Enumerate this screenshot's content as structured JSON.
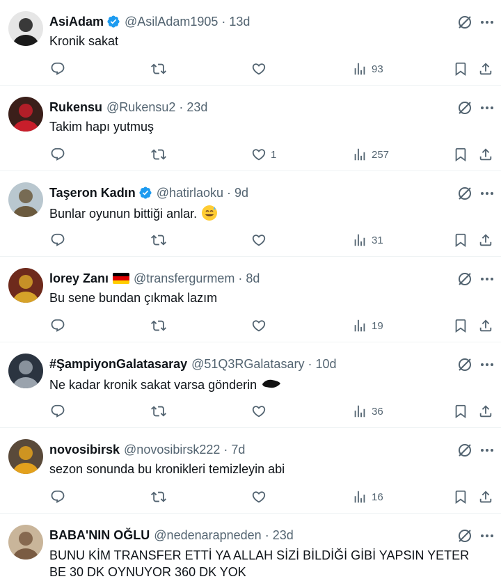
{
  "tweets": [
    {
      "name": "AsiAdam",
      "verified": true,
      "flag": false,
      "handle": "@AsilAdam1905",
      "dot": "·",
      "time": "13d",
      "text": "Kronik sakat",
      "emoji": "",
      "likes": "",
      "views": "93",
      "avatar_colors": [
        "#e6e6e6",
        "#1a1a1a"
      ]
    },
    {
      "name": "Rukensu",
      "verified": false,
      "flag": false,
      "handle": "@Rukensu2",
      "dot": "·",
      "time": "23d",
      "text": "Takim hapı yutmuş",
      "emoji": "",
      "likes": "1",
      "views": "257",
      "avatar_colors": [
        "#3b1f1a",
        "#c81e2b"
      ]
    },
    {
      "name": "Taşeron Kadın",
      "verified": true,
      "flag": false,
      "handle": "@hatirlaoku",
      "dot": "·",
      "time": "9d",
      "text": "Bunlar oyunun bittiği anlar.",
      "emoji": "sweat-smile-emoji",
      "likes": "",
      "views": "31",
      "avatar_colors": [
        "#b9c7cf",
        "#6b5a3e"
      ]
    },
    {
      "name": "lorey Zanı",
      "verified": false,
      "flag": true,
      "handle": "@transfergurmem",
      "dot": "·",
      "time": "8d",
      "text": "Bu sene bundan çıkmak lazım",
      "emoji": "",
      "likes": "",
      "views": "19",
      "avatar_colors": [
        "#6e2a1c",
        "#d6a229"
      ]
    },
    {
      "name": "#ŞampiyonGalatasaray",
      "verified": false,
      "flag": false,
      "handle": "@51Q3RGalatasary",
      "dot": "·",
      "time": "10d",
      "text": "Ne kadar kronik sakat varsa gönderin",
      "emoji": "redacted-blob",
      "likes": "",
      "views": "36",
      "avatar_colors": [
        "#2b3440",
        "#9aa3ad"
      ]
    },
    {
      "name": "novosibirsk",
      "verified": false,
      "flag": false,
      "handle": "@novosibirsk222",
      "dot": "·",
      "time": "7d",
      "text": "sezon sonunda bu kronikleri temizleyin abi",
      "emoji": "",
      "likes": "",
      "views": "16",
      "avatar_colors": [
        "#5a4a3a",
        "#e3a11d"
      ]
    },
    {
      "name": "BABA'NIN OĞLU",
      "verified": false,
      "flag": false,
      "handle": "@nedenarapneden",
      "dot": "·",
      "time": "23d",
      "text": "BUNU KİM TRANSFER ETTİ YA ALLAH SİZİ BİLDİĞİ GİBİ YAPSIN YETER BE 30 DK OYNUYOR 360 DK YOK",
      "emoji": "",
      "likes": "",
      "views": "",
      "avatar_colors": [
        "#c9b59a",
        "#7a5c43"
      ]
    }
  ],
  "colors": {
    "text": "#0f1419",
    "secondary": "#536471",
    "verified": "#1d9bf0",
    "divider": "#eff3f4"
  },
  "icons": [
    "reply-icon",
    "retweet-icon",
    "like-icon",
    "views-icon",
    "bookmark-icon",
    "share-icon",
    "grok-icon",
    "more-icon",
    "verified-badge-icon",
    "germany-flag-icon"
  ]
}
